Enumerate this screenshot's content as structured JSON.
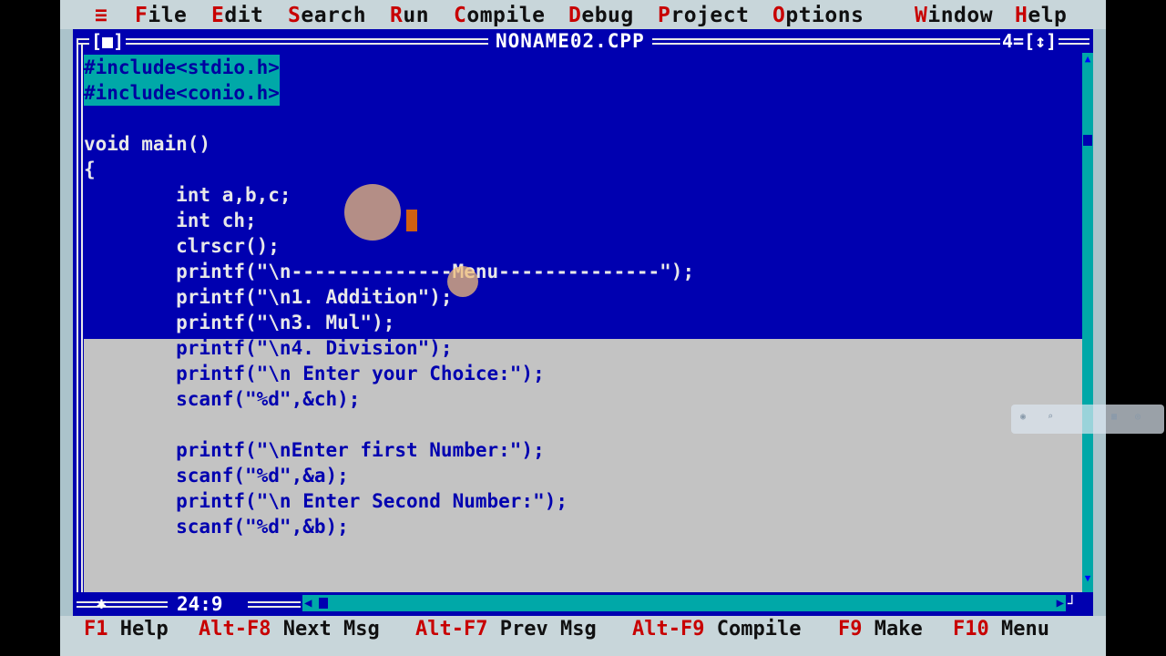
{
  "menu": {
    "system": "≡",
    "items": [
      {
        "hotkey": "F",
        "rest": "ile"
      },
      {
        "hotkey": "E",
        "rest": "dit"
      },
      {
        "hotkey": "S",
        "rest": "earch"
      },
      {
        "hotkey": "R",
        "rest": "un"
      },
      {
        "hotkey": "C",
        "rest": "ompile"
      },
      {
        "hotkey": "D",
        "rest": "ebug"
      },
      {
        "hotkey": "P",
        "rest": "roject"
      },
      {
        "hotkey": "O",
        "rest": "ptions"
      },
      {
        "hotkey": "W",
        "rest": "indow"
      },
      {
        "hotkey": "H",
        "rest": "elp"
      }
    ]
  },
  "window": {
    "close_box": "[■]",
    "title": "NONAME02.CPP",
    "number_zoom": "4=[↕]",
    "cursor_position": "24:9"
  },
  "code": [
    "#include<stdio.h>",
    "#include<conio.h>",
    "",
    "void main()",
    "{",
    "        int a,b,c;",
    "        int ch;",
    "        clrscr();",
    "        printf(\"\\n--------------Menu--------------\");",
    "        printf(\"\\n1. Addition\");",
    "        printf(\"\\n3. Mul\");",
    "        printf(\"\\n4. Division\");",
    "        printf(\"\\n Enter your Choice:\");",
    "        scanf(\"%d\",&ch);",
    "",
    "        printf(\"\\nEnter first Number:\");",
    "        scanf(\"%d\",&a);",
    "        printf(\"\\n Enter Second Number:\");",
    "        scanf(\"%d\",&b);"
  ],
  "status": [
    {
      "key": "F1",
      "label": "Help"
    },
    {
      "key": "Alt-F8",
      "label": "Next Msg"
    },
    {
      "key": "Alt-F7",
      "label": "Prev Msg"
    },
    {
      "key": "Alt-F9",
      "label": "Compile"
    },
    {
      "key": "F9",
      "label": "Make"
    },
    {
      "key": "F10",
      "label": "Menu"
    }
  ],
  "colors": {
    "editor_blue": "#0000b0",
    "selection_cyan": "#00a8a8",
    "hotkey_red": "#c80000",
    "menu_gray": "#c8d6da"
  }
}
